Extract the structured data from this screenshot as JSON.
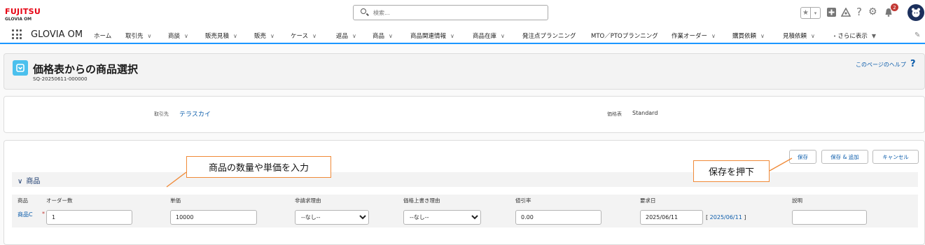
{
  "brand": {
    "logo": "FUJITSU",
    "sub": "GLOVIA OM"
  },
  "search": {
    "placeholder": "検索..."
  },
  "header_icons": {
    "badge_count": "2"
  },
  "nav": {
    "app_name": "GLOVIA OM",
    "items": [
      "ホーム",
      "取引先",
      "商談",
      "販売見積",
      "販売",
      "ケース",
      "返品",
      "商品",
      "商品関連情報",
      "商品在庫",
      "発注点プランニング",
      "MTO／PTOプランニング",
      "作業オーダー",
      "購買依頼",
      "見積依頼",
      "さらに表示"
    ]
  },
  "page_header": {
    "title": "価格表からの商品選択",
    "subtitle": "SQ-20250611-000000",
    "help": "このページのヘルプ"
  },
  "info": {
    "account_label": "取引先",
    "account_value": "テラスカイ",
    "pricebook_label": "価格表",
    "pricebook_value": "Standard"
  },
  "buttons": {
    "save": "保存",
    "save_add": "保存 & 追加",
    "cancel": "キャンセル"
  },
  "section": {
    "title": "商品"
  },
  "table": {
    "headers": [
      "商品",
      "オーダー数",
      "単価",
      "非請求理由",
      "価格上書き理由",
      "値引率",
      "要求日",
      "説明"
    ],
    "row": {
      "product": "商品C",
      "quantity": "1",
      "unit_price": "10000",
      "nonbill_reason": "--なし--",
      "override_reason": "--なし--",
      "discount": "0.00",
      "request_date": "2025/06/11",
      "today_link": "2025/06/11",
      "description": ""
    }
  },
  "callouts": {
    "input_hint": "商品の数量や単価を入力",
    "save_hint": "保存を押下"
  },
  "colors": {
    "accent": "#1b96ff",
    "link": "#0b5cab",
    "callout_border": "#f08a38",
    "brand_red": "#e60012"
  }
}
